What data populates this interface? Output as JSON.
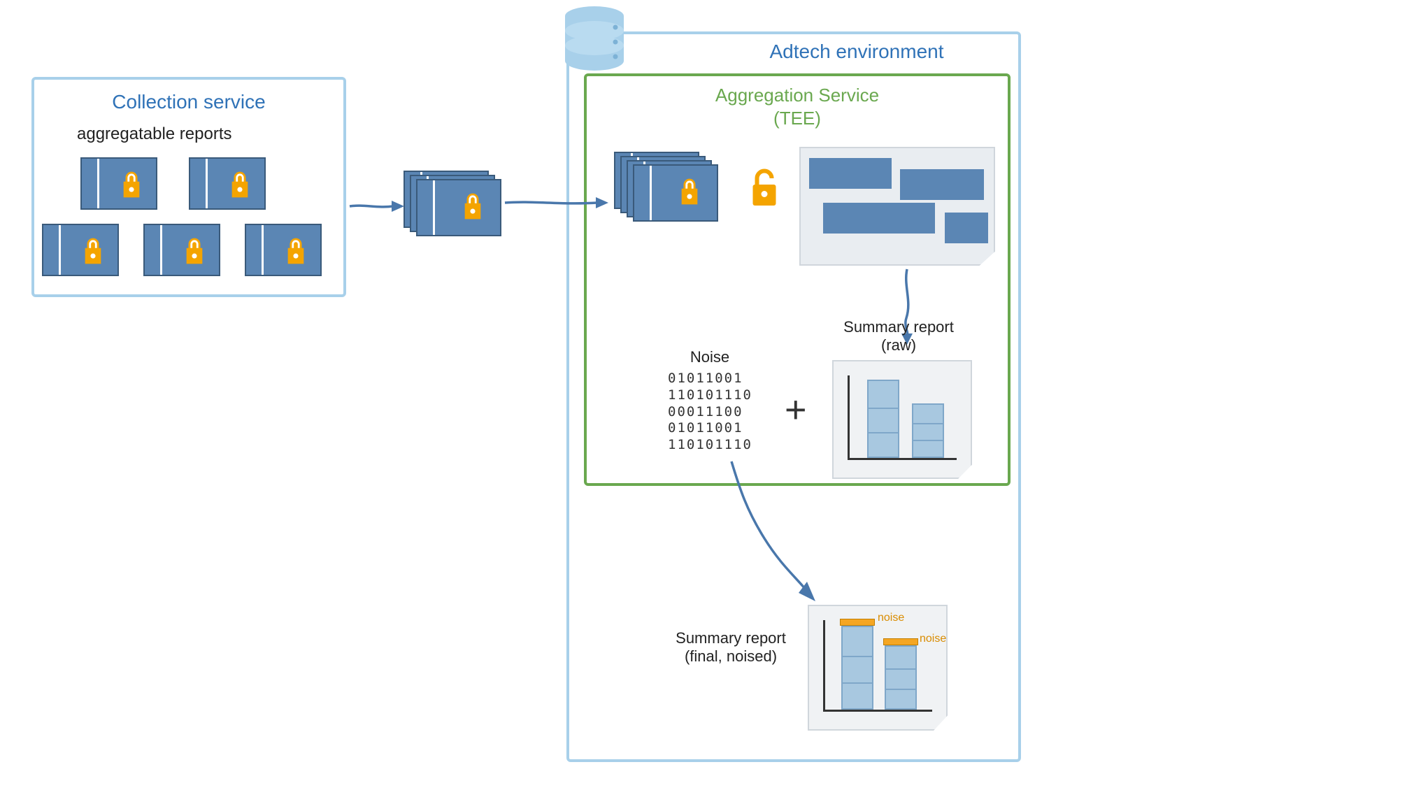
{
  "collection": {
    "title": "Collection service",
    "subtitle": "aggregatable reports"
  },
  "adtech": {
    "title": "Adtech environment"
  },
  "aggregation": {
    "title_line1": "Aggregation Service",
    "title_line2": "(TEE)"
  },
  "noise": {
    "label": "Noise",
    "lines": "01011001\n110101110\n00011100\n01011001\n110101110"
  },
  "plus": "+",
  "summary_raw": {
    "label_line1": "Summary report",
    "label_line2": "(raw)"
  },
  "summary_final": {
    "label_line1": "Summary report",
    "label_line2": "(final, noised)",
    "noise_tag": "noise"
  },
  "icons": {
    "database": "database-icon",
    "lock": "lock-icon",
    "unlock": "unlock-icon"
  }
}
